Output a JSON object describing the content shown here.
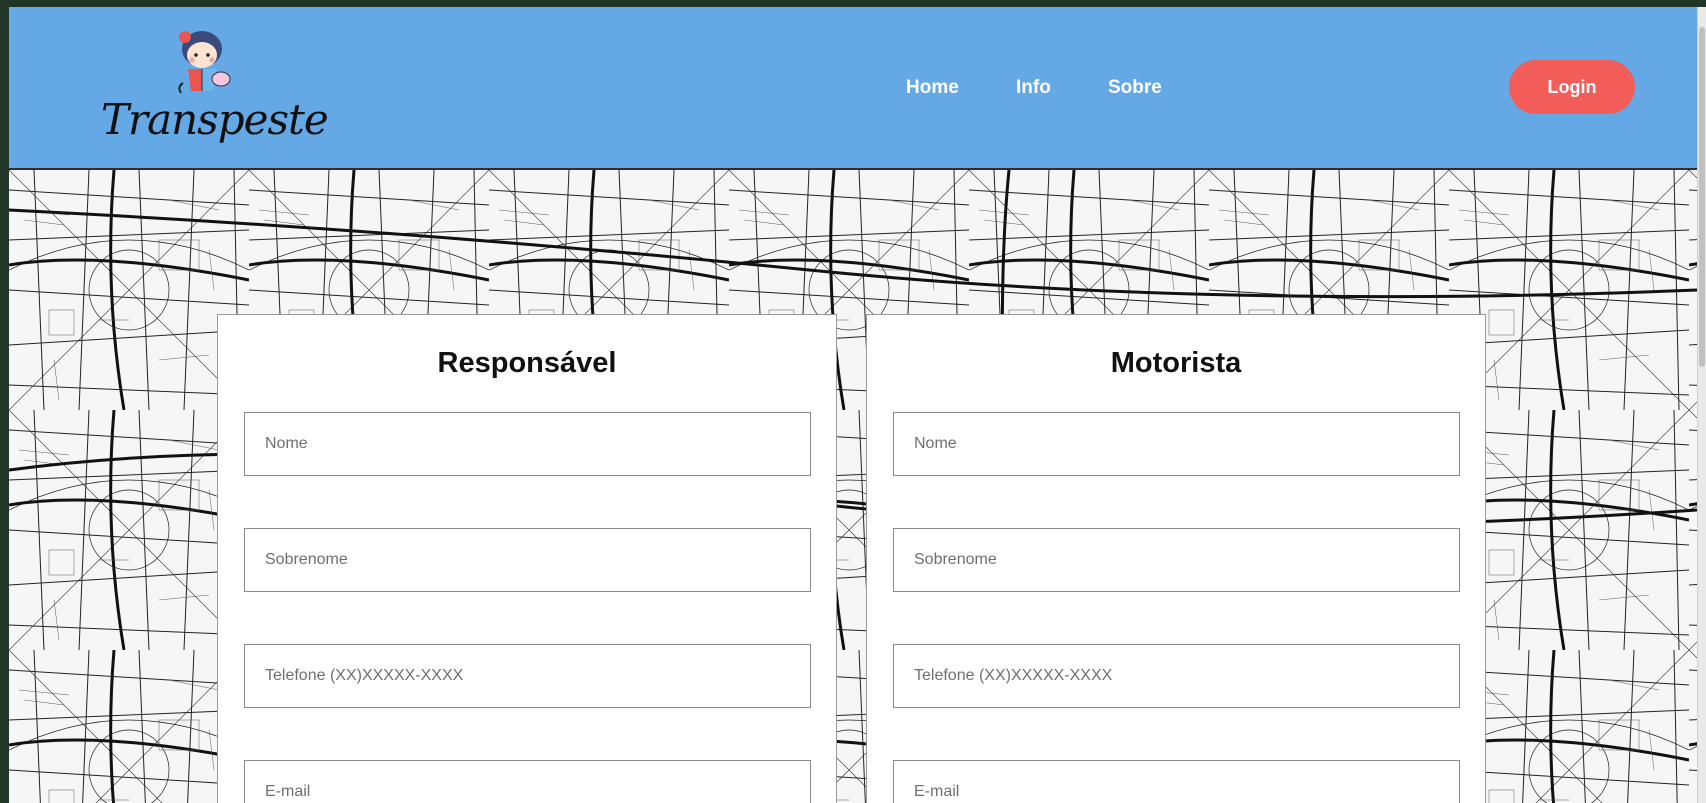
{
  "brand": {
    "name": "Transpeste"
  },
  "nav": {
    "home": "Home",
    "info": "Info",
    "sobre": "Sobre"
  },
  "header": {
    "login_label": "Login"
  },
  "forms": {
    "responsavel": {
      "title": "Responsável",
      "nome_placeholder": "Nome",
      "sobrenome_placeholder": "Sobrenome",
      "telefone_placeholder": "Telefone (XX)XXXXX-XXXX",
      "email_placeholder": "E-mail"
    },
    "motorista": {
      "title": "Motorista",
      "nome_placeholder": "Nome",
      "sobrenome_placeholder": "Sobrenome",
      "telefone_placeholder": "Telefone (XX)XXXXX-XXXX",
      "email_placeholder": "E-mail"
    }
  },
  "colors": {
    "header_bg": "#64a9e5",
    "login_bg": "#f25d5a",
    "nav_text": "#ffffff"
  }
}
